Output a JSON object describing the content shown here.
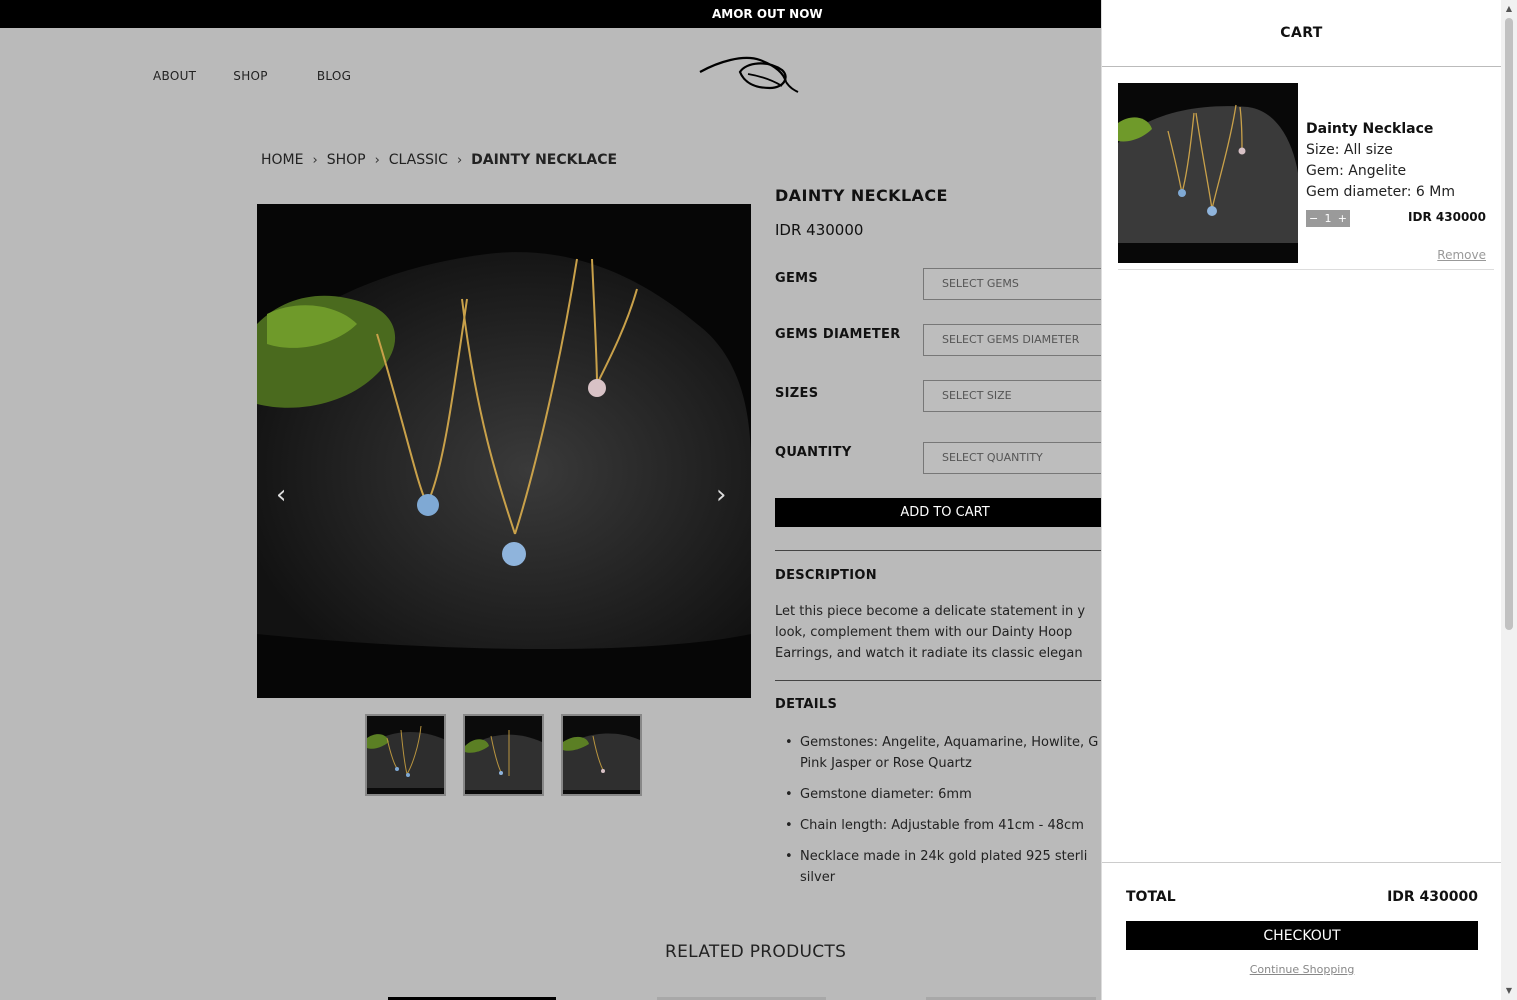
{
  "announcement": "AMOR OUT NOW",
  "nav": {
    "about": "ABOUT",
    "shop": "SHOP",
    "blog": "BLOG"
  },
  "breadcrumb": {
    "home": "HOME",
    "shop": "SHOP",
    "classic": "CLASSIC",
    "current": "DAINTY NECKLACE",
    "sep": "›"
  },
  "product": {
    "title": "DAINTY NECKLACE",
    "price": "IDR 430000",
    "options": {
      "gems_label": "GEMS",
      "gems_placeholder": "SELECT GEMS",
      "diameter_label": "GEMS DIAMETER",
      "diameter_placeholder": "SELECT GEMS DIAMETER",
      "sizes_label": "SIZES",
      "sizes_placeholder": "SELECT SIZE",
      "quantity_label": "QUANTITY",
      "quantity_placeholder": "SELECT QUANTITY"
    },
    "add_to_cart": "ADD TO CART",
    "description_title": "DESCRIPTION",
    "description": "Let this piece become a delicate statement in y look, complement them with our Dainty Hoop Earrings, and watch it radiate its classic elegan",
    "details_title": "DETAILS",
    "details": [
      "Gemstones: Angelite, Aquamarine, Howlite, G Pink Jasper or Rose Quartz",
      "Gemstone diameter: 6mm",
      "Chain length: Adjustable from 41cm - 48cm",
      "Necklace made in 24k gold plated 925 sterli silver"
    ],
    "related_title": "RELATED PRODUCTS"
  },
  "cart": {
    "title": "CART",
    "item": {
      "name": "Dainty Necklace",
      "size": "Size: All size",
      "gem": "Gem: Angelite",
      "diameter": "Gem diameter: 6 Mm",
      "qty": "1",
      "price": "IDR 430000",
      "remove": "Remove"
    },
    "total_label": "TOTAL",
    "total_value": "IDR 430000",
    "checkout": "CHECKOUT",
    "continue": "Continue Shopping"
  },
  "icons": {
    "prev": "chevron-left-icon",
    "next": "chevron-right-icon",
    "minus": "minus-icon",
    "plus": "plus-icon"
  }
}
